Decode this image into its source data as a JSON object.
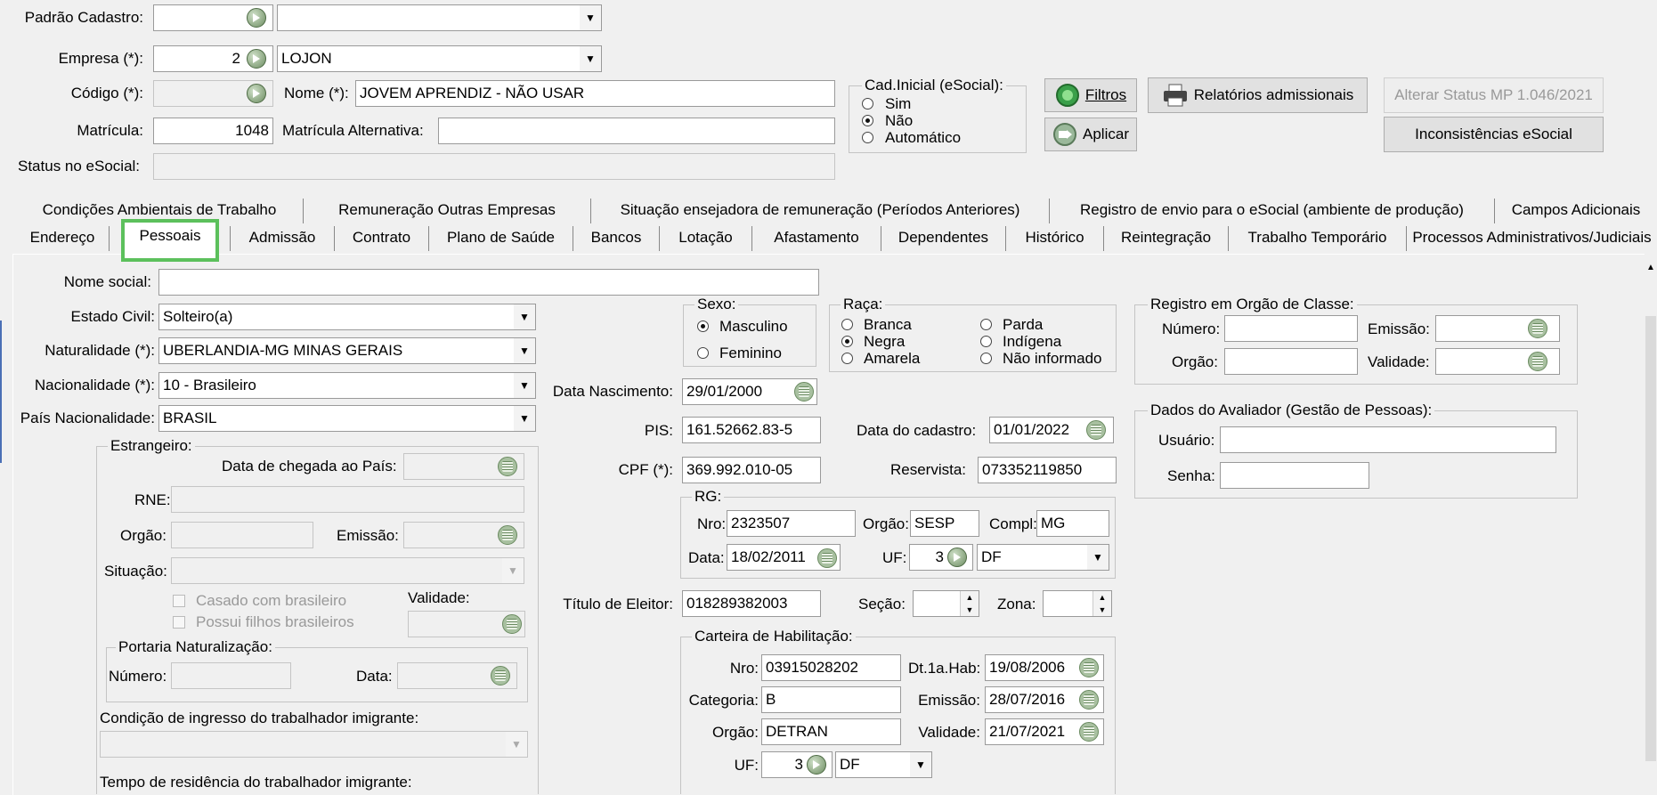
{
  "header": {
    "padrao_cadastro": {
      "label": "Padrão Cadastro:",
      "code": "",
      "name": ""
    },
    "empresa": {
      "label": "Empresa (*):",
      "code": "2",
      "name": "LOJON"
    },
    "codigo": {
      "label": "Código (*):",
      "value": ""
    },
    "nome": {
      "label": "Nome (*):",
      "value": "JOVEM APRENDIZ -  NÃO USAR"
    },
    "matricula": {
      "label": "Matrícula:",
      "value": "1048"
    },
    "matricula_alt": {
      "label": "Matrícula Alternativa:",
      "value": ""
    },
    "status_esocial": {
      "label": "Status no eSocial:",
      "value": ""
    }
  },
  "cad_inicial": {
    "title": "Cad.Inicial (eSocial):",
    "options": [
      "Sim",
      "Não",
      "Automático"
    ],
    "selected": "Não"
  },
  "buttons": {
    "filtros": "Filtros",
    "aplicar": "Aplicar",
    "relatorios": "Relatórios admissionais",
    "alterar_status": "Alterar Status MP 1.046/2021",
    "inconsistencias": "Inconsistências eSocial"
  },
  "tabs": {
    "row1": [
      "Condições Ambientais de Trabalho",
      "Remuneração Outras Empresas",
      "Situação ensejadora de remuneração (Períodos Anteriores)",
      "Registro de envio para o eSocial (ambiente de produção)",
      "Campos Adicionais"
    ],
    "row2": [
      "Endereço",
      "Pessoais",
      "Admissão",
      "Contrato",
      "Plano de Saúde",
      "Bancos",
      "Lotação",
      "Afastamento",
      "Dependentes",
      "Histórico",
      "Reintegração",
      "Trabalho Temporário",
      "Processos Administrativos/Judiciais"
    ],
    "active": "Pessoais",
    "highlight_color": "#5cc05c"
  },
  "pessoais": {
    "nome_social": {
      "label": "Nome social:",
      "value": ""
    },
    "estado_civil": {
      "label": "Estado Civil:",
      "value": "Solteiro(a)"
    },
    "naturalidade": {
      "label": "Naturalidade (*):",
      "value": "UBERLANDIA-MG MINAS GERAIS"
    },
    "nacionalidade": {
      "label": "Nacionalidade (*):",
      "value": "10 - Brasileiro"
    },
    "pais_nacionalidade": {
      "label": "País Nacionalidade:",
      "value": "BRASIL"
    },
    "estrangeiro": {
      "title": "Estrangeiro:",
      "data_chegada": "Data de chegada ao País:",
      "rne": "RNE:",
      "orgao": "Orgão:",
      "emissao": "Emissão:",
      "situacao": "Situação:",
      "casado": "Casado com brasileiro",
      "filhos": "Possui filhos brasileiros",
      "validade": "Validade:",
      "portaria_title": "Portaria Naturalização:",
      "numero": "Número:",
      "data": "Data:",
      "condicao": "Condição de ingresso do trabalhador imigrante:",
      "tempo": "Tempo de residência do trabalhador imigrante:"
    },
    "sexo": {
      "title": "Sexo:",
      "options": [
        "Masculino",
        "Feminino"
      ],
      "selected": "Masculino"
    },
    "raca": {
      "title": "Raça:",
      "options": [
        "Branca",
        "Negra",
        "Amarela",
        "Parda",
        "Indígena",
        "Não informado"
      ],
      "selected": "Negra"
    },
    "data_nascimento": {
      "label": "Data Nascimento:",
      "value": "29/01/2000"
    },
    "pis": {
      "label": "PIS:",
      "value": "161.52662.83-5"
    },
    "data_cadastro": {
      "label": "Data do cadastro:",
      "value": "01/01/2022"
    },
    "cpf": {
      "label": "CPF (*):",
      "value": "369.992.010-05"
    },
    "reservista": {
      "label": "Reservista:",
      "value": "073352119850"
    },
    "rg": {
      "title": "RG:",
      "nro_label": "Nro:",
      "nro": "2323507",
      "orgao_label": "Orgão:",
      "orgao": "SESP",
      "compl_label": "Compl:",
      "compl": "MG",
      "data_label": "Data:",
      "data": "18/02/2011",
      "uf_label": "UF:",
      "uf_code": "3",
      "uf": "DF"
    },
    "titulo_eleitor": {
      "label": "Título de Eleitor:",
      "value": "018289382003",
      "secao_label": "Seção:",
      "secao": "",
      "zona_label": "Zona:",
      "zona": ""
    },
    "cnh": {
      "title": "Carteira de Habilitação:",
      "nro_label": "Nro:",
      "nro": "03915028202",
      "dt1hab_label": "Dt.1a.Hab:",
      "dt1hab": "19/08/2006",
      "categoria_label": "Categoria:",
      "categoria": "B",
      "emissao_label": "Emissão:",
      "emissao": "28/07/2016",
      "orgao_label": "Orgão:",
      "orgao": "DETRAN",
      "validade_label": "Validade:",
      "validade": "21/07/2021",
      "uf_label": "UF:",
      "uf_code": "3",
      "uf": "DF"
    },
    "orgao_classe": {
      "title": "Registro em Orgão de Classe:",
      "numero": "Número:",
      "emissao": "Emissão:",
      "orgao": "Orgão:",
      "validade": "Validade:"
    },
    "avaliador": {
      "title": "Dados do Avaliador (Gestão de Pessoas):",
      "usuario": "Usuário:",
      "senha": "Senha:"
    }
  }
}
